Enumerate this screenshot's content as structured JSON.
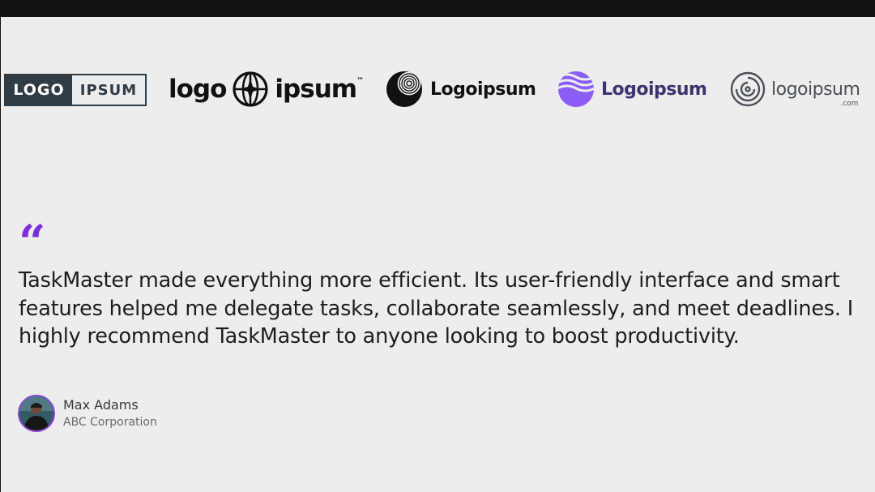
{
  "logos": [
    {
      "part1": "LOGO",
      "part2": "IPSUM",
      "icon": "none"
    },
    {
      "part1": "logo",
      "part2": "ipsum",
      "trademark": "™",
      "icon": "globe-icon"
    },
    {
      "text": "Logoipsum",
      "icon": "halftone-sphere-icon"
    },
    {
      "text": "Logoipsum",
      "icon": "wave-circle-icon",
      "color": "#3c3470",
      "accent": "#8b5cf6"
    },
    {
      "text": "logoipsum",
      "suffix": ".com",
      "icon": "spiral-icon"
    }
  ],
  "testimonial": {
    "quote_mark": "“",
    "quote": "TaskMaster made everything more efficient. Its user-friendly interface and smart features helped me delegate tasks, collaborate seamlessly, and meet deadlines. I highly recommend TaskMaster to anyone looking to boost productivity.",
    "author_name": "Max Adams",
    "author_company": "ABC Corporation",
    "accent_color": "#7b2fd8"
  }
}
